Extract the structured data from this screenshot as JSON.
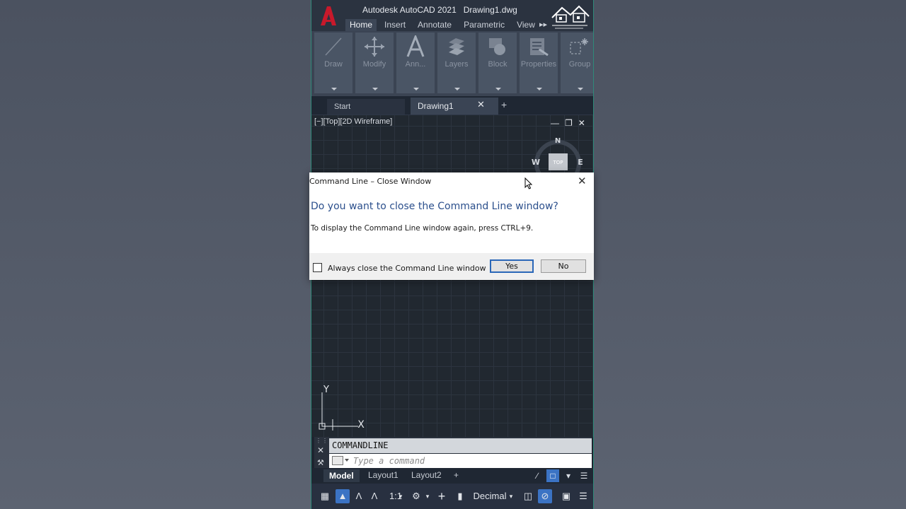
{
  "window": {
    "app_title": "Autodesk AutoCAD 2021",
    "file_title": "Drawing1.dwg"
  },
  "ribbon": {
    "tabs": [
      {
        "label": "Home",
        "active": true
      },
      {
        "label": "Insert",
        "active": false
      },
      {
        "label": "Annotate",
        "active": false
      },
      {
        "label": "Parametric",
        "active": false
      },
      {
        "label": "View",
        "active": false
      }
    ],
    "more_icon": "double-chevron-right-icon",
    "panels": [
      {
        "label": "Draw",
        "icon": "line-icon"
      },
      {
        "label": "Modify",
        "icon": "move-icon"
      },
      {
        "label": "Ann...",
        "icon": "text-icon"
      },
      {
        "label": "Layers",
        "icon": "layers-icon"
      },
      {
        "label": "Block",
        "icon": "block-icon"
      },
      {
        "label": "Properties",
        "icon": "properties-icon"
      },
      {
        "label": "Group",
        "icon": "group-icon"
      }
    ]
  },
  "file_tabs": {
    "start_label": "Start",
    "drawing_label": "Drawing1",
    "close_symbol": "✕",
    "new_symbol": "+"
  },
  "viewport": {
    "label": "[−][Top][2D Wireframe]",
    "compass": {
      "n": "N",
      "w": "W",
      "e": "E",
      "cube": "TOP"
    },
    "ucs": {
      "y": "Y",
      "x": "X"
    }
  },
  "command_line": {
    "history": "COMMANDLINE",
    "placeholder": "Type a command"
  },
  "layout_tabs": {
    "tabs": [
      {
        "label": "Model",
        "active": true
      },
      {
        "label": "Layout1",
        "active": false
      },
      {
        "label": "Layout2",
        "active": false
      }
    ],
    "add_symbol": "+"
  },
  "status_bar": {
    "scale": "1:1",
    "units": "Decimal"
  },
  "dialog": {
    "title": "Command Line – Close Window",
    "heading": "Do you want to close the Command Line window?",
    "body": "To display the Command Line window again, press CTRL+9.",
    "checkbox_label": "Always close the Command Line window",
    "checkbox_checked": false,
    "yes_label": "Yes",
    "no_label": "No"
  },
  "colors": {
    "accent": "#3b73c4",
    "autocad_red": "#c8192b",
    "dialog_heading": "#2b4f8c"
  }
}
